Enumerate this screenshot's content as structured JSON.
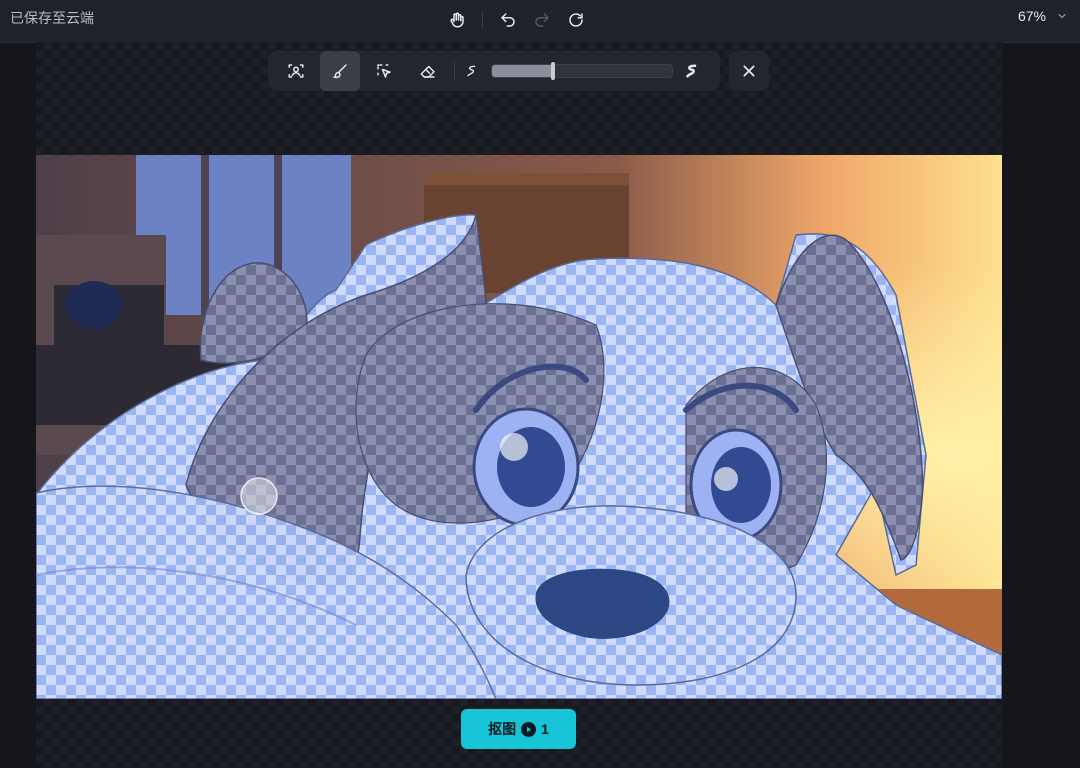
{
  "app": {
    "save_status": "已保存至云端",
    "zoom_level": "67%"
  },
  "history": {
    "icons": [
      "hand-icon",
      "undo-icon",
      "redo-icon",
      "reset-icon"
    ],
    "redo_enabled": false
  },
  "toolbar": {
    "tools": [
      "portrait-select-icon",
      "brush-icon",
      "smart-select-icon",
      "eraser-icon"
    ],
    "active_tool": "brush-icon",
    "brush_size_fraction": 0.34
  },
  "primary_action": {
    "label": "抠图",
    "credit_cost": "1"
  },
  "colors": {
    "accent": "#17c4d8",
    "mask_tint": "#8fb6ff"
  }
}
